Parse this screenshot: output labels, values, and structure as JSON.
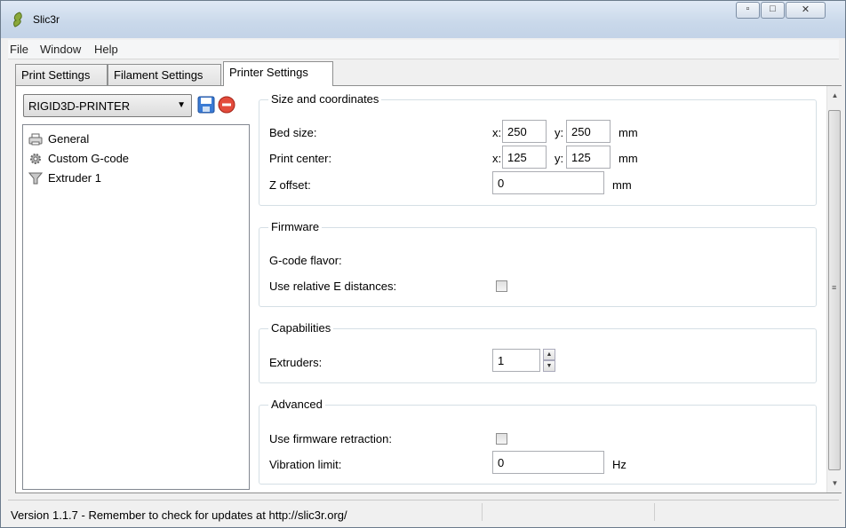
{
  "window": {
    "title": "Slic3r"
  },
  "menu": {
    "file": "File",
    "window": "Window",
    "help": "Help"
  },
  "tabs": [
    {
      "label": "Print Settings"
    },
    {
      "label": "Filament Settings"
    },
    {
      "label": "Printer Settings"
    }
  ],
  "preset": {
    "value": "RIGID3D-PRINTER"
  },
  "tree": [
    {
      "label": "General",
      "icon": "printer-icon"
    },
    {
      "label": "Custom G-code",
      "icon": "gear-icon"
    },
    {
      "label": "Extruder 1",
      "icon": "funnel-icon"
    }
  ],
  "size": {
    "title": "Size and coordinates",
    "bed_label": "Bed size:",
    "bed_x": "250",
    "bed_y": "250",
    "center_label": "Print center:",
    "center_x": "125",
    "center_y": "125",
    "z_label": "Z offset:",
    "z_value": "0",
    "x_prefix": "x:",
    "y_prefix": "y:",
    "unit": "mm"
  },
  "firmware": {
    "title": "Firmware",
    "flavor_label": "G-code flavor:",
    "relative_e_label": "Use relative E distances:"
  },
  "capabilities": {
    "title": "Capabilities",
    "extruders_label": "Extruders:",
    "extruders_value": "1"
  },
  "advanced": {
    "title": "Advanced",
    "fw_retraction_label": "Use firmware retraction:",
    "vibration_label": "Vibration limit:",
    "vibration_value": "0",
    "vibration_unit": "Hz"
  },
  "status": {
    "text": "Version 1.1.7 - Remember to check for updates at http://slic3r.org/"
  }
}
